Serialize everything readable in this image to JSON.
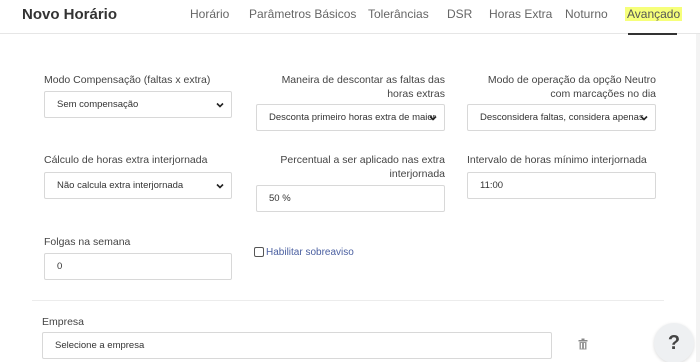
{
  "header": {
    "title": "Novo Horário",
    "tabs": [
      {
        "label": "Horário"
      },
      {
        "label": "Parâmetros Básicos"
      },
      {
        "label": "Tolerâncias"
      },
      {
        "label": "DSR"
      },
      {
        "label": "Horas Extra"
      },
      {
        "label": "Noturno"
      },
      {
        "label": "Avançado"
      }
    ],
    "active_tab": "Avançado"
  },
  "form": {
    "modo_compensacao": {
      "label": "Modo Compensação (faltas x extra)",
      "value": "Sem compensação"
    },
    "maneira_descontar": {
      "label": "Maneira de descontar as faltas das horas extras",
      "value": "Desconta primeiro horas extra de maior"
    },
    "modo_operacao_neutro": {
      "label": "Modo de operação da opção Neutro com marcações no dia",
      "value": "Desconsidera faltas, considera apenas"
    },
    "calculo_extra_interjornada": {
      "label": "Cálculo de horas extra interjornada",
      "value": "Não calcula extra interjornada"
    },
    "percentual_extra_interjornada": {
      "label": "Percentual a ser aplicado nas extra interjornada",
      "value": "50 %"
    },
    "intervalo_minimo_interjornada": {
      "label": "Intervalo de horas mínimo interjornada",
      "value": "11:00"
    },
    "folgas_semana": {
      "label": "Folgas na semana",
      "value": "0"
    },
    "habilitar_sobreaviso": {
      "label": "Habilitar sobreaviso",
      "checked": false
    },
    "empresa": {
      "label": "Empresa",
      "placeholder": "Selecione a empresa"
    }
  },
  "help_button": {
    "label": "?"
  },
  "colors": {
    "active_tab_highlight": "#f6ff7a",
    "checkbox_label": "#4a5fa0"
  },
  "icons": [
    "chevron-down-icon",
    "trash-icon",
    "help-icon"
  ]
}
